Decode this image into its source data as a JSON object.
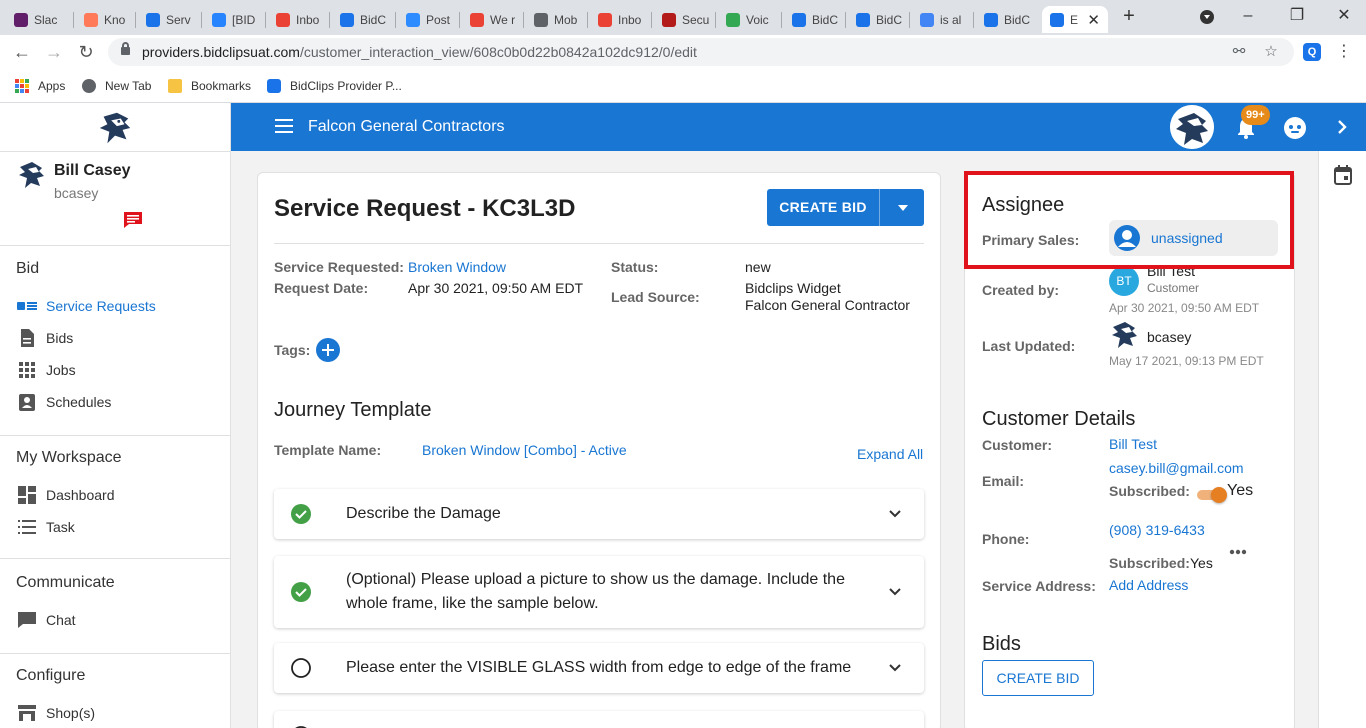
{
  "browser": {
    "tabs": [
      {
        "label": "Slac",
        "color": "#611f69"
      },
      {
        "label": "Kno",
        "color": "#ff7a59"
      },
      {
        "label": "Serv",
        "color": "#1a73e8"
      },
      {
        "label": "[BID",
        "color": "#2684ff"
      },
      {
        "label": "Inbo",
        "color": "#ea4335"
      },
      {
        "label": "BidC",
        "color": "#1a73e8"
      },
      {
        "label": "Post",
        "color": "#2d8cff"
      },
      {
        "label": "We r",
        "color": "#ea4335"
      },
      {
        "label": "Mob",
        "color": "#5f6368"
      },
      {
        "label": "Inbo",
        "color": "#ea4335"
      },
      {
        "label": "Secu",
        "color": "#b31b1b"
      },
      {
        "label": "Voic",
        "color": "#34a853"
      },
      {
        "label": "BidC",
        "color": "#1a73e8"
      },
      {
        "label": "BidC",
        "color": "#1a73e8"
      },
      {
        "label": "is al",
        "color": "#4285f4"
      },
      {
        "label": "BidC",
        "color": "#1a73e8"
      },
      {
        "label": "E",
        "color": "#1a73e8"
      }
    ],
    "new_tab": "+",
    "url_host": "providers.bidclipsuat.com",
    "url_path": "/customer_interaction_view/608c0b0d22b0842a102dc912/0/edit",
    "bookmarks": [
      {
        "label": "Apps"
      },
      {
        "label": "New Tab"
      },
      {
        "label": "Bookmarks"
      },
      {
        "label": "BidClips Provider P..."
      }
    ],
    "ext_label": "Q"
  },
  "sidebar": {
    "user_name": "Bill Casey",
    "user_handle": "bcasey",
    "sections": [
      {
        "title": "Bid"
      },
      {
        "title": "My Workspace"
      },
      {
        "title": "Communicate"
      },
      {
        "title": "Configure"
      }
    ],
    "items": [
      {
        "label": "Service Requests",
        "icon": "service-requests-icon",
        "active": true
      },
      {
        "label": "Bids",
        "icon": "document-icon"
      },
      {
        "label": "Jobs",
        "icon": "grid-icon"
      },
      {
        "label": "Schedules",
        "icon": "contact-card-icon"
      },
      {
        "label": "Dashboard",
        "icon": "dashboard-icon"
      },
      {
        "label": "Task",
        "icon": "list-icon"
      },
      {
        "label": "Chat",
        "icon": "chat-icon"
      },
      {
        "label": "Shop(s)",
        "icon": "shop-icon"
      }
    ]
  },
  "appbar": {
    "company": "Falcon General Contractors",
    "badge": "99+",
    "brand_color": "#1976d2"
  },
  "request": {
    "title": "Service Request - KC3L3D",
    "create_bid_label": "CREATE BID",
    "service_requested_label": "Service Requested:",
    "service_requested_value": "Broken Window",
    "request_date_label": "Request Date:",
    "request_date_value": "Apr 30 2021, 09:50 AM EDT",
    "status_label": "Status:",
    "status_value": "new",
    "lead_source_label": "Lead Source:",
    "lead_source_line1": "Bidclips Widget",
    "lead_source_line2": "Falcon General Contractor",
    "tags_label": "Tags:",
    "journey_title": "Journey Template",
    "template_name_label": "Template Name:",
    "template_name_value": "Broken Window [Combo] - Active",
    "expand_all": "Expand All",
    "steps": [
      {
        "text": "Describe the Damage",
        "done": true
      },
      {
        "text": "(Optional) Please upload a picture to show us the damage. Include the whole frame, like the sample below.",
        "done": true
      },
      {
        "text": "Please enter the VISIBLE GLASS width from edge to edge of the frame",
        "done": false
      }
    ],
    "success_color": "#43a047"
  },
  "details": {
    "assignee_title": "Assignee",
    "primary_sales_label": "Primary Sales:",
    "primary_sales_value": "unassigned",
    "created_by_label": "Created by:",
    "created_by_initials": "BT",
    "created_by_name": "Bill Test",
    "created_by_role": "Customer",
    "created_date": "Apr 30 2021, 09:50 AM EDT",
    "last_updated_label": "Last Updated:",
    "last_updated_name": "bcasey",
    "last_updated_date": "May 17 2021, 09:13 PM EDT",
    "customer_details_title": "Customer Details",
    "customer_label": "Customer:",
    "customer_value": "Bill Test",
    "email_label": "Email:",
    "email_value": "casey.bill@gmail.com",
    "subscribed_label": "Subscribed:",
    "email_subscribed_value": "Yes",
    "phone_label": "Phone:",
    "phone_value": "(908) 319-6433",
    "phone_subscribed_value": "Yes",
    "service_address_label": "Service Address:",
    "service_address_value": "Add Address",
    "bids_title": "Bids",
    "bids_button": "CREATE BID",
    "highlight_color": "#e0121b"
  }
}
